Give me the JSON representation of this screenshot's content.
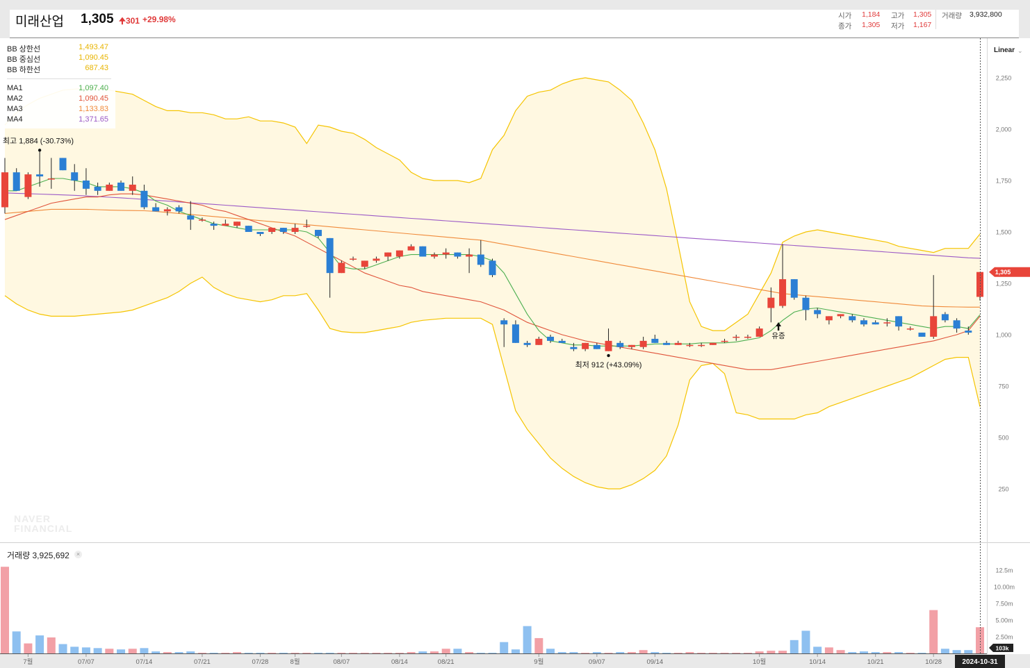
{
  "header": {
    "name": "미래산업",
    "price": "1,305",
    "change": "301",
    "change_pct": "+29.98%",
    "open_label": "시가",
    "open": "1,184",
    "high_label": "고가",
    "high": "1,305",
    "close_label": "종가",
    "close": "1,305",
    "low_label": "저가",
    "low": "1,167",
    "volume_label": "거래량",
    "volume": "3,932,800"
  },
  "legend": [
    {
      "name": "BB 상한선",
      "value": "1,493.47",
      "color": "#e8b400"
    },
    {
      "name": "BB 중심선",
      "value": "1,090.45",
      "color": "#e8b400"
    },
    {
      "name": "BB 하한선",
      "value": "687.43",
      "color": "#e8b400"
    },
    {
      "name": "MA1",
      "value": "1,097.40",
      "color": "#4caf50"
    },
    {
      "name": "MA2",
      "value": "1,090.45",
      "color": "#e0533a"
    },
    {
      "name": "MA3",
      "value": "1,133.83",
      "color": "#f08a3a"
    },
    {
      "name": "MA4",
      "value": "1,371.65",
      "color": "#9b59c6"
    }
  ],
  "scale": {
    "label": "Linear"
  },
  "volume_panel": {
    "label": "거래량 3,925,692",
    "close": "×",
    "last_tag": "103k"
  },
  "watermark": [
    "NAVER",
    "FINANCIAL"
  ],
  "colors": {
    "up": "#e8453a",
    "down": "#2b7fd4",
    "volume_up": "#f2a0a6",
    "volume_down": "#8ec0f0",
    "band_fill": "#fff8e1",
    "band_line": "#f5c400"
  },
  "chart_data": {
    "type": "candlestick",
    "price_axis": {
      "ticks": [
        250,
        500,
        750,
        "1,000",
        "1,250",
        "1,500",
        "1,750",
        "2,000",
        "2,250"
      ],
      "ylim": [
        0,
        2400
      ]
    },
    "volume_axis": {
      "ticks": [
        "2.50m",
        "5.00m",
        "7.50m",
        "10.00m",
        "12.5m"
      ],
      "ylim": [
        0,
        13500000
      ]
    },
    "x_ticks": [
      "7월",
      "07/07",
      "07/14",
      "07/21",
      "07/28",
      "8월",
      "08/07",
      "08/14",
      "08/21",
      "9월",
      "09/07",
      "09/14",
      "10월",
      "10/14",
      "10/21",
      "10/28"
    ],
    "current_date": "2024-10-31",
    "current_price_tag": "1,305",
    "annotations": {
      "high": "최고 1,884 (-30.73%)",
      "low": "최저 912 (+43.09%)",
      "event": "유증"
    },
    "candles": [
      [
        1620,
        1860,
        1590,
        1790
      ],
      [
        1790,
        1810,
        1700,
        1700
      ],
      [
        1670,
        1790,
        1660,
        1780
      ],
      [
        1780,
        1890,
        1720,
        1770
      ],
      [
        1760,
        1860,
        1710,
        1760
      ],
      [
        1860,
        1860,
        1800,
        1800
      ],
      [
        1790,
        1830,
        1700,
        1750
      ],
      [
        1750,
        1810,
        1680,
        1710
      ],
      [
        1720,
        1740,
        1680,
        1700
      ],
      [
        1700,
        1740,
        1700,
        1730
      ],
      [
        1740,
        1750,
        1700,
        1700
      ],
      [
        1700,
        1770,
        1680,
        1730
      ],
      [
        1700,
        1730,
        1610,
        1620
      ],
      [
        1620,
        1640,
        1600,
        1600
      ],
      [
        1600,
        1620,
        1580,
        1610
      ],
      [
        1620,
        1630,
        1590,
        1600
      ],
      [
        1580,
        1650,
        1510,
        1560
      ],
      [
        1560,
        1570,
        1550,
        1560
      ],
      [
        1540,
        1550,
        1510,
        1530
      ],
      [
        1530,
        1560,
        1530,
        1540
      ],
      [
        1530,
        1550,
        1520,
        1550
      ],
      [
        1530,
        1530,
        1500,
        1500
      ],
      [
        1500,
        1500,
        1480,
        1490
      ],
      [
        1500,
        1520,
        1490,
        1520
      ],
      [
        1520,
        1520,
        1490,
        1500
      ],
      [
        1500,
        1540,
        1490,
        1520
      ],
      [
        1530,
        1560,
        1520,
        1530
      ],
      [
        1510,
        1510,
        1470,
        1480
      ],
      [
        1470,
        1470,
        1180,
        1300
      ],
      [
        1300,
        1360,
        1300,
        1350
      ],
      [
        1370,
        1380,
        1360,
        1370
      ],
      [
        1330,
        1360,
        1320,
        1360
      ],
      [
        1360,
        1380,
        1350,
        1370
      ],
      [
        1380,
        1400,
        1360,
        1400
      ],
      [
        1380,
        1410,
        1370,
        1410
      ],
      [
        1410,
        1440,
        1420,
        1430
      ],
      [
        1430,
        1430,
        1380,
        1380
      ],
      [
        1380,
        1400,
        1370,
        1390
      ],
      [
        1390,
        1420,
        1370,
        1400
      ],
      [
        1400,
        1400,
        1370,
        1380
      ],
      [
        1380,
        1420,
        1300,
        1390
      ],
      [
        1390,
        1460,
        1330,
        1340
      ],
      [
        1360,
        1370,
        1280,
        1290
      ],
      [
        1070,
        1080,
        940,
        1050
      ],
      [
        1050,
        1070,
        960,
        960
      ],
      [
        960,
        970,
        940,
        950
      ],
      [
        950,
        990,
        950,
        980
      ],
      [
        990,
        1000,
        960,
        970
      ],
      [
        970,
        980,
        960,
        960
      ],
      [
        940,
        960,
        920,
        930
      ],
      [
        930,
        960,
        920,
        960
      ],
      [
        950,
        960,
        930,
        930
      ],
      [
        920,
        1030,
        920,
        970
      ],
      [
        960,
        970,
        930,
        940
      ],
      [
        940,
        950,
        930,
        950
      ],
      [
        940,
        990,
        930,
        970
      ],
      [
        980,
        1000,
        960,
        960
      ],
      [
        960,
        970,
        950,
        950
      ],
      [
        950,
        970,
        950,
        960
      ],
      [
        950,
        960,
        940,
        950
      ],
      [
        950,
        960,
        940,
        950
      ],
      [
        950,
        960,
        950,
        960
      ],
      [
        970,
        980,
        960,
        970
      ],
      [
        990,
        1000,
        970,
        990
      ],
      [
        990,
        1000,
        980,
        990
      ],
      [
        990,
        1040,
        990,
        1030
      ],
      [
        1130,
        1230,
        1060,
        1180
      ],
      [
        1140,
        1440,
        1130,
        1270
      ],
      [
        1270,
        1270,
        1170,
        1180
      ],
      [
        1180,
        1190,
        1070,
        1120
      ],
      [
        1120,
        1130,
        1080,
        1100
      ],
      [
        1070,
        1090,
        1050,
        1090
      ],
      [
        1090,
        1100,
        1080,
        1100
      ],
      [
        1090,
        1100,
        1060,
        1070
      ],
      [
        1070,
        1080,
        1040,
        1050
      ],
      [
        1060,
        1070,
        1050,
        1050
      ],
      [
        1060,
        1080,
        1040,
        1060
      ],
      [
        1090,
        1090,
        1020,
        1040
      ],
      [
        1030,
        1040,
        1020,
        1030
      ],
      [
        1010,
        1010,
        990,
        990
      ],
      [
        990,
        1290,
        980,
        1090
      ],
      [
        1100,
        1110,
        1060,
        1070
      ],
      [
        1070,
        1080,
        1010,
        1030
      ],
      [
        1020,
        1040,
        1000,
        1010
      ],
      [
        1184,
        1305,
        1167,
        1305
      ]
    ],
    "volume": [
      13000000,
      3300000,
      1500000,
      2700000,
      2400000,
      1400000,
      1000000,
      900000,
      800000,
      700000,
      600000,
      700000,
      800000,
      300000,
      200000,
      200000,
      300000,
      100000,
      100000,
      100000,
      200000,
      100000,
      100000,
      100000,
      100000,
      100000,
      100000,
      100000,
      100000,
      100000,
      100000,
      100000,
      100000,
      100000,
      100000,
      200000,
      300000,
      300000,
      700000,
      700000,
      200000,
      100000,
      100000,
      1700000,
      600000,
      4100000,
      2300000,
      700000,
      200000,
      200000,
      100000,
      200000,
      100000,
      200000,
      200000,
      500000,
      200000,
      100000,
      100000,
      200000,
      100000,
      100000,
      100000,
      100000,
      100000,
      300000,
      400000,
      400000,
      2000000,
      3400000,
      1000000,
      900000,
      500000,
      200000,
      300000,
      200000,
      200000,
      200000,
      100000,
      100000,
      6500000,
      700000,
      500000,
      500000,
      3930000
    ],
    "bollinger": {
      "upper": [
        2020,
        2080,
        2120,
        2150,
        2170,
        2190,
        2195,
        2200,
        2200,
        2190,
        2180,
        2170,
        2140,
        2110,
        2090,
        2090,
        2080,
        2080,
        2070,
        2050,
        2050,
        2060,
        2040,
        2040,
        2030,
        2010,
        1930,
        2020,
        2010,
        1990,
        1980,
        1950,
        1910,
        1880,
        1850,
        1790,
        1760,
        1750,
        1750,
        1750,
        1740,
        1760,
        1900,
        1970,
        2090,
        2160,
        2180,
        2190,
        2220,
        2240,
        2250,
        2240,
        2230,
        2190,
        2140,
        2030,
        1900,
        1710,
        1440,
        1160,
        1040,
        1020,
        1020,
        1060,
        1100,
        1200,
        1300,
        1450,
        1480,
        1500,
        1510,
        1500,
        1490,
        1480,
        1470,
        1460,
        1450,
        1430,
        1420,
        1410,
        1400,
        1420,
        1420,
        1420,
        1490
      ],
      "lower": [
        1190,
        1150,
        1120,
        1100,
        1090,
        1090,
        1090,
        1095,
        1100,
        1105,
        1110,
        1120,
        1140,
        1160,
        1180,
        1210,
        1250,
        1280,
        1230,
        1200,
        1180,
        1170,
        1160,
        1170,
        1190,
        1190,
        1200,
        1120,
        1030,
        1015,
        1010,
        1010,
        1020,
        1030,
        1040,
        1060,
        1070,
        1075,
        1080,
        1080,
        1080,
        1080,
        1050,
        840,
        630,
        540,
        470,
        400,
        350,
        310,
        280,
        260,
        250,
        250,
        270,
        300,
        340,
        410,
        560,
        780,
        850,
        860,
        810,
        620,
        610,
        590,
        590,
        590,
        590,
        610,
        620,
        650,
        670,
        690,
        710,
        730,
        750,
        770,
        790,
        820,
        850,
        880,
        890,
        890,
        650
      ]
    },
    "moving_averages": {
      "ma1": [
        1700,
        1700,
        1720,
        1740,
        1760,
        1760,
        1750,
        1740,
        1720,
        1720,
        1720,
        1710,
        1690,
        1650,
        1630,
        1600,
        1580,
        1560,
        1540,
        1530,
        1520,
        1510,
        1510,
        1510,
        1510,
        1510,
        1500,
        1470,
        1400,
        1330,
        1320,
        1320,
        1340,
        1360,
        1380,
        1390,
        1390,
        1390,
        1390,
        1390,
        1390,
        1380,
        1360,
        1300,
        1200,
        1100,
        1020,
        970,
        960,
        950,
        950,
        945,
        945,
        945,
        945,
        950,
        955,
        955,
        955,
        955,
        960,
        960,
        960,
        965,
        975,
        985,
        1020,
        1070,
        1110,
        1125,
        1130,
        1120,
        1110,
        1100,
        1090,
        1080,
        1070,
        1060,
        1050,
        1040,
        1030,
        1040,
        1040,
        1030,
        1097
      ],
      "ma2": [
        1560,
        1580,
        1600,
        1620,
        1640,
        1650,
        1660,
        1670,
        1670,
        1680,
        1685,
        1685,
        1680,
        1670,
        1660,
        1650,
        1640,
        1630,
        1610,
        1600,
        1580,
        1560,
        1540,
        1520,
        1500,
        1480,
        1450,
        1420,
        1390,
        1360,
        1330,
        1300,
        1280,
        1260,
        1240,
        1230,
        1210,
        1200,
        1190,
        1180,
        1170,
        1160,
        1140,
        1120,
        1090,
        1060,
        1040,
        1020,
        1000,
        985,
        970,
        960,
        950,
        940,
        930,
        920,
        910,
        900,
        890,
        880,
        870,
        860,
        850,
        840,
        830,
        830,
        830,
        840,
        850,
        860,
        870,
        880,
        890,
        900,
        910,
        920,
        930,
        940,
        950,
        960,
        970,
        985,
        1000,
        1020,
        1090
      ],
      "ma3": [
        1590,
        1595,
        1600,
        1605,
        1610,
        1610,
        1610,
        1610,
        1608,
        1606,
        1605,
        1604,
        1603,
        1600,
        1595,
        1590,
        1585,
        1580,
        1575,
        1570,
        1565,
        1560,
        1555,
        1550,
        1545,
        1540,
        1535,
        1530,
        1525,
        1520,
        1515,
        1510,
        1505,
        1500,
        1495,
        1490,
        1485,
        1480,
        1475,
        1470,
        1465,
        1460,
        1450,
        1440,
        1430,
        1420,
        1410,
        1400,
        1390,
        1380,
        1370,
        1360,
        1350,
        1340,
        1330,
        1320,
        1310,
        1300,
        1290,
        1280,
        1270,
        1260,
        1250,
        1240,
        1230,
        1220,
        1210,
        1200,
        1195,
        1190,
        1185,
        1180,
        1175,
        1170,
        1165,
        1160,
        1155,
        1150,
        1145,
        1140,
        1138,
        1136,
        1135,
        1134,
        1134
      ],
      "ma4": [
        1690,
        1688,
        1686,
        1684,
        1682,
        1680,
        1678,
        1675,
        1672,
        1669,
        1666,
        1662,
        1658,
        1654,
        1650,
        1646,
        1642,
        1638,
        1634,
        1630,
        1626,
        1622,
        1618,
        1614,
        1610,
        1606,
        1602,
        1598,
        1594,
        1590,
        1586,
        1582,
        1578,
        1574,
        1570,
        1566,
        1562,
        1558,
        1554,
        1550,
        1546,
        1542,
        1538,
        1534,
        1530,
        1526,
        1522,
        1518,
        1514,
        1510,
        1506,
        1502,
        1498,
        1494,
        1490,
        1486,
        1482,
        1478,
        1474,
        1470,
        1466,
        1462,
        1458,
        1454,
        1450,
        1446,
        1442,
        1438,
        1434,
        1430,
        1426,
        1422,
        1418,
        1414,
        1410,
        1406,
        1402,
        1398,
        1394,
        1390,
        1386,
        1382,
        1378,
        1374,
        1372
      ]
    }
  }
}
